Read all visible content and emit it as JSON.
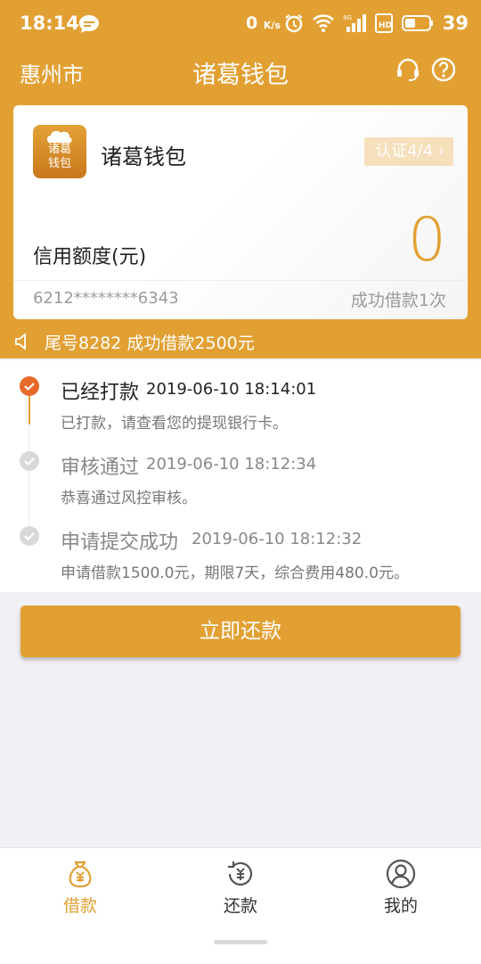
{
  "status_bar": {
    "time": "18:14",
    "net_speed": "0",
    "net_unit": "K/s",
    "battery": "39"
  },
  "nav": {
    "city": "惠州市",
    "title": "诸葛钱包"
  },
  "card": {
    "logo_text_1": "诸葛",
    "logo_text_2": "钱包",
    "name": "诸葛钱包",
    "cert_label": "认证4/4",
    "credit_label": "信用额度(元)",
    "credit_value": "0",
    "account": "6212********6343",
    "success_count": "成功借款1次"
  },
  "notice": {
    "text": "尾号8282 成功借款2500元"
  },
  "timeline": [
    {
      "title": "已经打款",
      "time": "2019-06-10 18:14:01",
      "desc": "已打款，请查看您的提现银行卡。",
      "active": true
    },
    {
      "title": "审核通过",
      "time": "2019-06-10 18:12:34",
      "desc": "恭喜通过风控审核。",
      "active": false
    },
    {
      "title": "申请提交成功",
      "time": "2019-06-10 18:12:32",
      "desc": "申请借款1500.0元，期限7天，综合费用480.0元。",
      "active": false
    }
  ],
  "repay_button": "立即还款",
  "tabs": [
    {
      "label": "借款",
      "icon": "money-bag-icon",
      "active": true
    },
    {
      "label": "还款",
      "icon": "repay-cycle-icon",
      "active": false
    },
    {
      "label": "我的",
      "icon": "user-icon",
      "active": false
    }
  ],
  "colors": {
    "accent": "#e2a033",
    "checked": "#e8692a",
    "inactive_dot": "#d4d4d4",
    "text_muted": "#777777"
  }
}
